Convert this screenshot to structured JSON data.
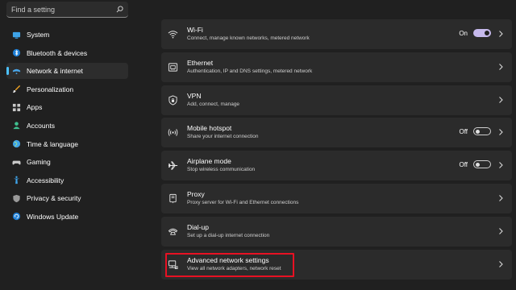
{
  "search": {
    "placeholder": "Find a setting",
    "icon": "search-icon"
  },
  "sidebar": {
    "items": [
      {
        "label": "System",
        "icon": "system-icon",
        "active": false
      },
      {
        "label": "Bluetooth & devices",
        "icon": "bluetooth-icon",
        "active": false
      },
      {
        "label": "Network & internet",
        "icon": "network-icon",
        "active": true
      },
      {
        "label": "Personalization",
        "icon": "brush-icon",
        "active": false
      },
      {
        "label": "Apps",
        "icon": "apps-icon",
        "active": false
      },
      {
        "label": "Accounts",
        "icon": "accounts-icon",
        "active": false
      },
      {
        "label": "Time & language",
        "icon": "globe-icon",
        "active": false
      },
      {
        "label": "Gaming",
        "icon": "gamepad-icon",
        "active": false
      },
      {
        "label": "Accessibility",
        "icon": "accessibility-icon",
        "active": false
      },
      {
        "label": "Privacy & security",
        "icon": "shield-icon",
        "active": false
      },
      {
        "label": "Windows Update",
        "icon": "update-icon",
        "active": false
      }
    ]
  },
  "cards": [
    {
      "title": "Wi-Fi",
      "subtitle": "Connect, manage known networks, metered network",
      "icon": "wifi-icon",
      "toggle": "On"
    },
    {
      "title": "Ethernet",
      "subtitle": "Authentication, IP and DNS settings, metered network",
      "icon": "ethernet-icon"
    },
    {
      "title": "VPN",
      "subtitle": "Add, connect, manage",
      "icon": "vpn-shield-icon"
    },
    {
      "title": "Mobile hotspot",
      "subtitle": "Share your internet connection",
      "icon": "hotspot-icon",
      "toggle": "Off"
    },
    {
      "title": "Airplane mode",
      "subtitle": "Stop wireless communication",
      "icon": "airplane-icon",
      "toggle": "Off"
    },
    {
      "title": "Proxy",
      "subtitle": "Proxy server for Wi-Fi and Ethernet connections",
      "icon": "proxy-icon"
    },
    {
      "title": "Dial-up",
      "subtitle": "Set up a dial-up internet connection",
      "icon": "dialup-icon"
    },
    {
      "title": "Advanced network settings",
      "subtitle": "View all network adapters, network reset",
      "icon": "advanced-network-icon"
    }
  ],
  "colors": {
    "accent": "#4cc2ff",
    "toggle_on": "#c6b9ec",
    "highlight": "#e81123",
    "card_bg": "#2b2b2b",
    "page_bg": "#202020"
  }
}
